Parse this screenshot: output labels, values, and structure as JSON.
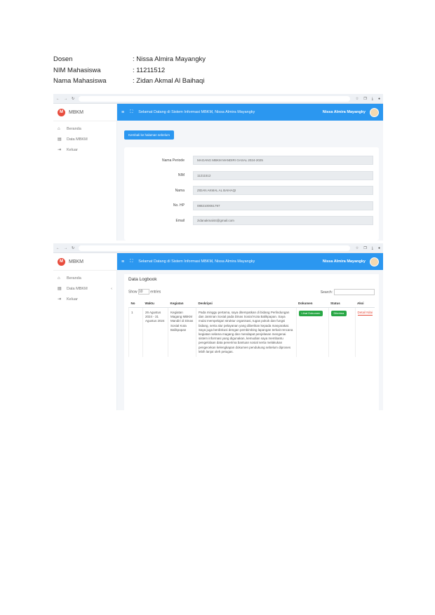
{
  "header": {
    "rows": [
      {
        "label": "Dosen",
        "value": ": Nissa Almira Mayangky"
      },
      {
        "label": "NIM  Mahasiswa",
        "value": ": 11211512"
      },
      {
        "label": "Nama Mahasiswa",
        "value": ": Zidan Akmal Al Baihaqi"
      }
    ]
  },
  "shot1": {
    "app_name": "MBKM",
    "topbar_title": "Selamat Datang di Sistem Informasi MBKM, Nissa Almira Mayangky",
    "user_name": "Nissa Almira Mayangky",
    "menu": [
      "Beranda",
      "Data MBKM",
      "Keluar"
    ],
    "button_label": "Kembali ke halaman sebelum",
    "fields": [
      {
        "label": "Nama Periode",
        "value": "MAGANG MBKM MANDIRI GASAL 2024-2025"
      },
      {
        "label": "NIM",
        "value": "11211512"
      },
      {
        "label": "Nama",
        "value": "ZIDAN AKMAL AL BAIHAQI"
      },
      {
        "label": "No. HP",
        "value": "0882100061797"
      },
      {
        "label": "Email",
        "value": "zidanakmal44@gmail.com"
      }
    ]
  },
  "shot2": {
    "app_name": "MBKM",
    "topbar_title": "Selamat Datang di Sistem Informasi MBKM, Nissa Almira Mayangky",
    "user_name": "Nissa Almira Mayangky",
    "menu": [
      "Beranda",
      "Data MBKM",
      "Keluar"
    ],
    "card_title": "Data Logbook",
    "show_label": "Show",
    "show_value": "10",
    "entries_label": "entries",
    "search_label": "Search:",
    "columns": [
      "No",
      "Waktu",
      "Kegiatan",
      "Deskripsi",
      "Dokumen",
      "Status",
      "Aksi"
    ],
    "row": {
      "no": "1",
      "waktu": "26 Agustus 2024 - 31 Agustus 2024",
      "kegiatan": "Kegiatan Magang MBKM Mandiri di Dinas Sosial Kota Balikpapan",
      "deskripsi": "Pada minggu pertama, saya ditempatkan di bidang Perlindungan dan Jaminan Sosial pada Dinas Sosial Kota Balikpapan. Saya mulai mempelajari struktur organisasi, tugas pokok dan fungsi bidang, serta alur pelayanan yang diberikan kepada masyarakat. Saya juga berdiskusi dengan pembimbing lapangan terkait rencana kegiatan selama magang dan mendapat penjelasan mengenai sistem informasi yang digunakan, kemudian saya membantu pengelolaan data penerima bantuan sosial serta melakukan pengecekan kelengkapan dokumen pendukung sebelum diproses lebih lanjut oleh petugas.",
      "dokumen": "Lihat Dokumen",
      "status": "Diterima",
      "aksi": "Detail Nilai"
    }
  }
}
